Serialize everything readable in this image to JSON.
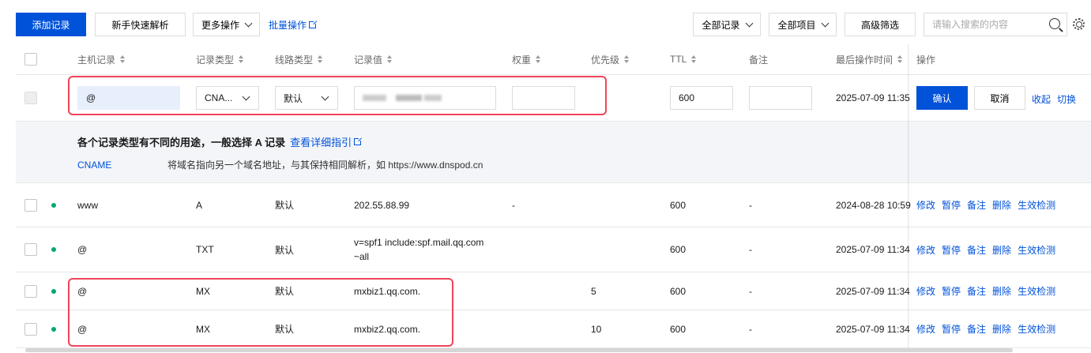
{
  "toolbar": {
    "add_record": "添加记录",
    "quick_parse": "新手快速解析",
    "more_ops": "更多操作",
    "batch_ops": "批量操作",
    "all_records": "全部记录",
    "all_items": "全部项目",
    "advanced_filter": "高级筛选",
    "search_placeholder": "请输入搜索的内容"
  },
  "columns": [
    "主机记录",
    "记录类型",
    "线路类型",
    "记录值",
    "权重",
    "优先级",
    "TTL",
    "备注",
    "最后操作时间",
    "操作"
  ],
  "edit_row": {
    "host": "@",
    "type": "CNA...",
    "line": "默认",
    "ttl": "600",
    "time": "2025-07-09 11:35",
    "confirm": "确认",
    "cancel": "取消",
    "collapse": "收起",
    "switch": "切换"
  },
  "hint": {
    "title": "各个记录类型有不同的用途，一般选择 A 记录",
    "guide_link": "查看详细指引",
    "type": "CNAME",
    "desc": "将域名指向另一个域名地址，与其保持相同解析，如 https://www.dnspod.cn"
  },
  "actions": [
    "修改",
    "暂停",
    "备注",
    "删除",
    "生效检测"
  ],
  "records": [
    {
      "host": "www",
      "type": "A",
      "line": "默认",
      "value": "202.55.88.99",
      "weight": "-",
      "priority": "",
      "ttl": "600",
      "note": "-",
      "time": "2024-08-28 10:59"
    },
    {
      "host": "@",
      "type": "TXT",
      "line": "默认",
      "value": "v=spf1 include:spf.mail.qq.com ~all",
      "weight": "",
      "priority": "",
      "ttl": "600",
      "note": "-",
      "time": "2025-07-09 11:34"
    },
    {
      "host": "@",
      "type": "MX",
      "line": "默认",
      "value": "mxbiz1.qq.com.",
      "weight": "",
      "priority": "5",
      "ttl": "600",
      "note": "-",
      "time": "2025-07-09 11:34"
    },
    {
      "host": "@",
      "type": "MX",
      "line": "默认",
      "value": "mxbiz2.qq.com.",
      "weight": "",
      "priority": "10",
      "ttl": "600",
      "note": "-",
      "time": "2025-07-09 11:34"
    }
  ],
  "colors": {
    "primary": "#0052d9",
    "status_ok": "#00a870",
    "highlight": "#f0445a"
  }
}
